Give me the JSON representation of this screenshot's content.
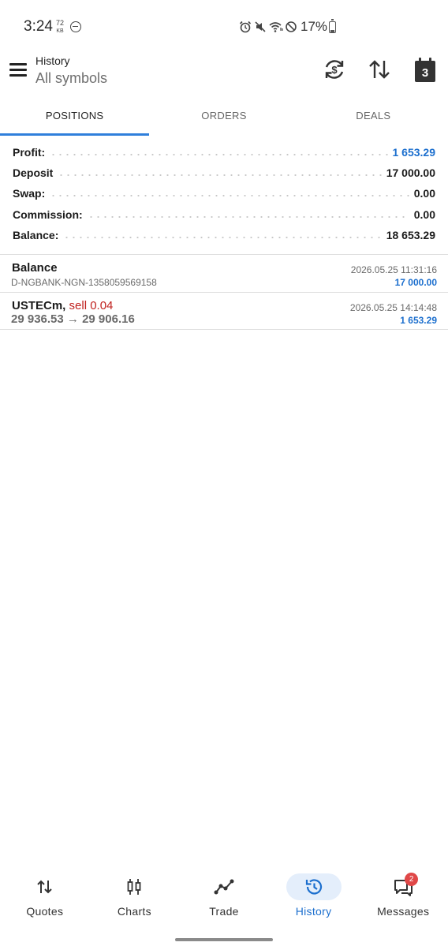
{
  "status_bar": {
    "time": "3:24",
    "data_rate_value": "72",
    "data_rate_unit": "KB",
    "battery": "17%"
  },
  "toolbar": {
    "title": "History",
    "subtitle": "All symbols",
    "calendar_day": "3",
    "actions": [
      "currency-refresh-icon",
      "sort-icon",
      "calendar-icon"
    ]
  },
  "tabs": [
    {
      "label": "POSITIONS",
      "active": true
    },
    {
      "label": "ORDERS",
      "active": false
    },
    {
      "label": "DEALS",
      "active": false
    }
  ],
  "summary": [
    {
      "label": "Profit:",
      "value": "1 653.29",
      "color": "#1c6fce"
    },
    {
      "label": "Deposit",
      "value": "17 000.00",
      "color": "#1b1b1b"
    },
    {
      "label": "Swap:",
      "value": "0.00",
      "color": "#1b1b1b"
    },
    {
      "label": "Commission:",
      "value": "0.00",
      "color": "#1b1b1b"
    },
    {
      "label": "Balance:",
      "value": "18 653.29",
      "color": "#1b1b1b"
    }
  ],
  "deals": [
    {
      "name": "Balance",
      "detail": "D-NGBANK-NGN-1358059569158",
      "time": "2026.05.25 11:31:16",
      "amount": "17 000.00"
    },
    {
      "name": "USTECm,",
      "side": "sell 0.04",
      "prices": "29 936.53 → 29 906.16",
      "time": "2026.05.25 14:14:48",
      "amount": "1 653.29"
    }
  ],
  "bottom_nav": [
    {
      "label": "Quotes",
      "icon": "quotes-icon",
      "active": false
    },
    {
      "label": "Charts",
      "icon": "charts-icon",
      "active": false
    },
    {
      "label": "Trade",
      "icon": "trade-icon",
      "active": false
    },
    {
      "label": "History",
      "icon": "history-icon",
      "active": true
    },
    {
      "label": "Messages",
      "icon": "messages-icon",
      "active": false,
      "badge": "2"
    }
  ],
  "colors": {
    "accent": "#1c6fce",
    "tab_indicator": "#2f7fdb",
    "sell": "#c0221f",
    "badge": "#e04848"
  }
}
